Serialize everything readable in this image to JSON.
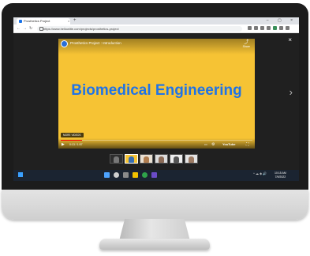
{
  "browser": {
    "tab_title": "Prosthetics Project",
    "tab_close": "×",
    "new_tab": "+",
    "window_controls": "– ▢ ×",
    "back": "←",
    "forward": "→",
    "reload": "↻",
    "url": "https://www.hellowlite.com/projects/prosthetics-project"
  },
  "viewer": {
    "close": "×",
    "next_arrow": "›",
    "video": {
      "channel_title": "Prosthetics Project : Introduction",
      "share_label": "Share",
      "share_icon": "⤴",
      "headline": "Biomedical Engineering",
      "more_videos": "MORE VIDEOS",
      "play": "▶",
      "volume": "🔊",
      "time": "0:13 / 1:57",
      "cc": "▭",
      "settings": "⚙",
      "youtube": "YouTube",
      "fullscreen": "⛶",
      "progress": 0.11,
      "bg_color": "#f6c334",
      "headline_color": "#1f73e8"
    },
    "thumbnails": [
      "slide-1",
      "slide-2",
      "slide-3",
      "slide-4",
      "slide-5",
      "slide-6"
    ]
  },
  "taskbar": {
    "tray_icons": "^ ☁ ◈ 🔊",
    "time": "10:15 AM",
    "date": "7/9/2022"
  }
}
